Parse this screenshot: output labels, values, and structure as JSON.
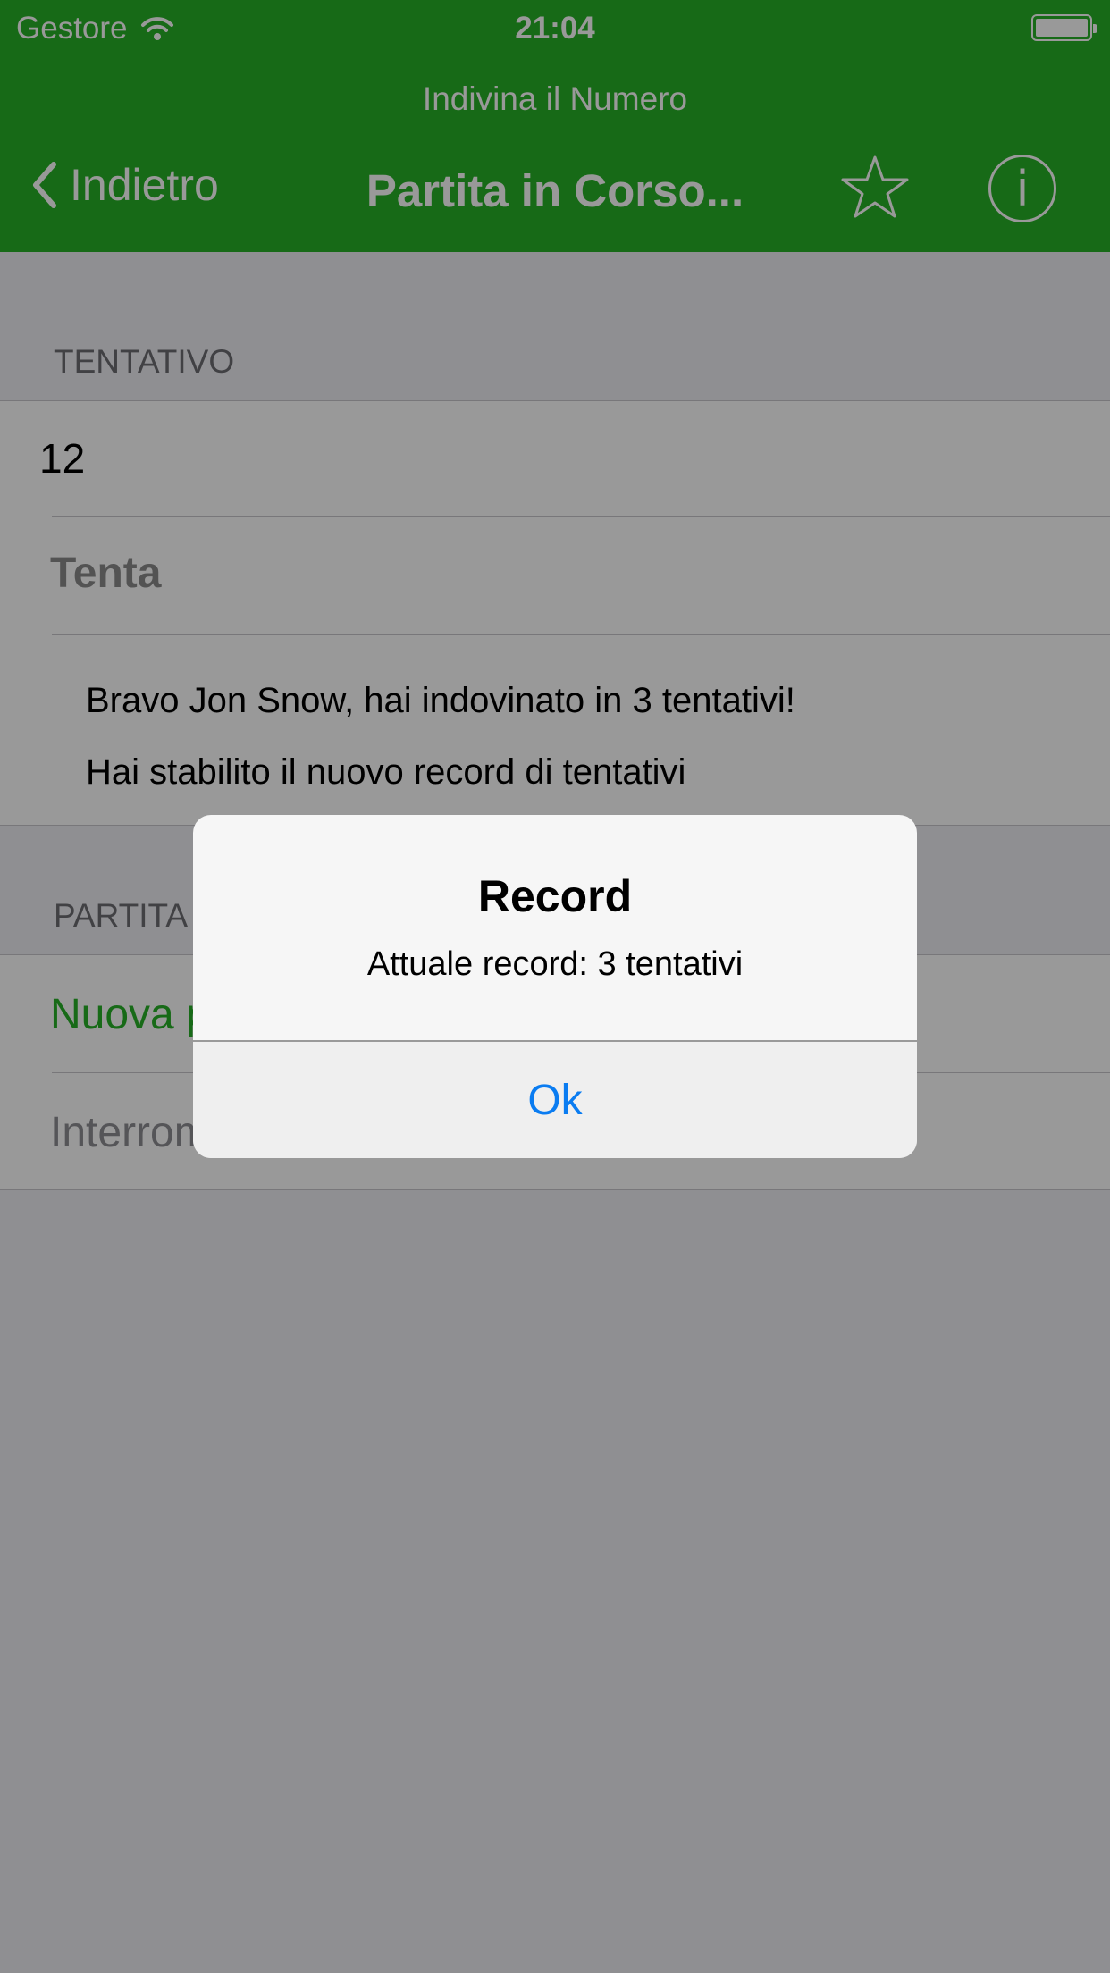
{
  "status_bar": {
    "carrier": "Gestore",
    "time": "21:04"
  },
  "nav": {
    "app_title": "Indivina il Numero",
    "back_label": "Indietro",
    "title": "Partita in Corso..."
  },
  "sections": {
    "tentativo": {
      "header": "TENTATIVO",
      "input_value": "12",
      "guess_button": "Tenta",
      "message_line1": "Bravo Jon Snow, hai indovinato in 3 tentativi!",
      "message_line2": "Hai stabilito il nuovo record di tentativi"
    },
    "partita": {
      "header": "PARTITA",
      "new_game": "Nuova partita",
      "stop_game": "Interrompi partita"
    }
  },
  "alert": {
    "title": "Record",
    "message": "Attuale record: 3 tentativi",
    "ok_label": "Ok"
  },
  "colors": {
    "nav_green": "#27b127",
    "link_blue": "#0a7cf1"
  }
}
